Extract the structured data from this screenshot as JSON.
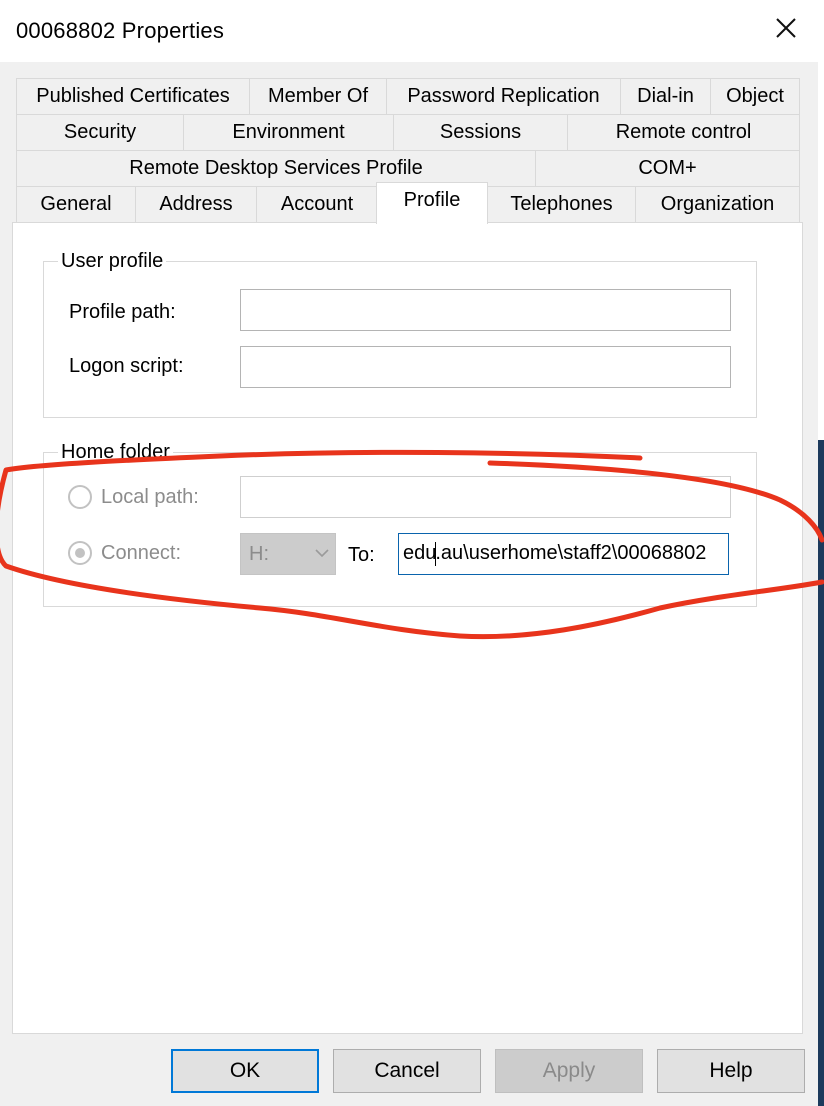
{
  "window": {
    "title": "00068802 Properties",
    "close_icon": "close-icon"
  },
  "tabs": {
    "row1": [
      "Published Certificates",
      "Member Of",
      "Password Replication",
      "Dial-in",
      "Object"
    ],
    "row2": [
      "Security",
      "Environment",
      "Sessions",
      "Remote control"
    ],
    "row3": [
      "Remote Desktop Services Profile",
      "COM+"
    ],
    "row4": [
      "General",
      "Address",
      "Account",
      "Profile",
      "Telephones",
      "Organization"
    ],
    "active": "Profile"
  },
  "user_profile": {
    "group_label": "User profile",
    "profile_path_label": "Profile path:",
    "profile_path_value": "",
    "logon_script_label": "Logon script:",
    "logon_script_value": ""
  },
  "home_folder": {
    "group_label": "Home folder",
    "local_path_label": "Local path:",
    "local_path_value": "",
    "connect_label": "Connect:",
    "connect_selected": true,
    "drive_value": "H:",
    "to_label": "To:",
    "to_value_before_caret": "edu",
    "to_value_after_caret": ".au\\userhome\\staff2\\00068802"
  },
  "buttons": {
    "ok": "OK",
    "cancel": "Cancel",
    "apply": "Apply",
    "help": "Help"
  },
  "colors": {
    "annotation_stroke": "#e8341c",
    "focus_border": "#0a64ad",
    "default_button_border": "#0078d7"
  }
}
